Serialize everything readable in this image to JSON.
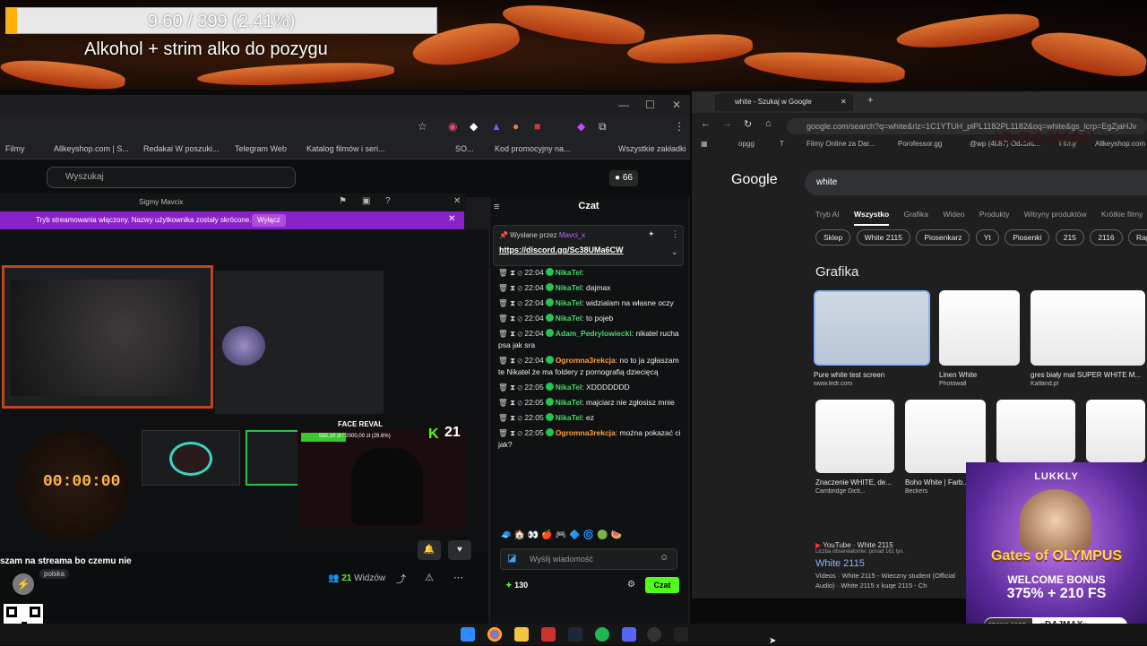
{
  "overlay": {
    "progress_text": "9.60 / 399 (2.41%)",
    "progress_fraction": 0.0241,
    "stream_title": "Alkohol + strim alko do pozygu"
  },
  "left_browser": {
    "bookmarks": [
      "Filmy",
      "Allkeyshop.com | S...",
      "Redakai W poszuki...",
      "Telegram Web",
      "Katalog filmów i seri...",
      "SO...",
      "Kod promocyjny na...",
      "Wszystkie zakładki"
    ],
    "search_placeholder": "Wyszukaj",
    "viewer_badge": "66"
  },
  "popout": {
    "window_title": "Sigmy Mavcix",
    "notice": "Tryb streamowania włączony. Nazwy użytkownika zostały skrócone.",
    "notice_button": "Wyłącz",
    "timer": "00:00:00",
    "face_reveal": "FACE REVAL",
    "goal_text": "592,10 zł / 2000,00 zł (29.6%)",
    "kick_count": "21"
  },
  "stream_info": {
    "description": "szam na streama bo czemu nie",
    "tag": "polska",
    "viewers_count": "21",
    "viewers_label": "Widzów"
  },
  "chat": {
    "title": "Czat",
    "pinned_by": "Wysłane przez",
    "pinned_user": "Mavci_x",
    "pinned_link": "https://discord.gg/Sc38UMa6CW",
    "messages": [
      {
        "time": "22:04",
        "user": "NikaTel",
        "text": ":",
        "color": "green"
      },
      {
        "time": "22:04",
        "user": "NikaTel",
        "text": ": dajmax",
        "color": "green"
      },
      {
        "time": "22:04",
        "user": "NikaTel",
        "text": ": widzialam na własne oczy",
        "color": "green"
      },
      {
        "time": "22:04",
        "user": "NikaTel",
        "text": ": to pojeb",
        "color": "green"
      },
      {
        "time": "22:04",
        "user": "Adam_Pedrylowiecki",
        "text": ": nikatel rucha psa jak sra",
        "color": "green"
      },
      {
        "time": "22:04",
        "user": "Ogromna3rekcja",
        "text": ": no to ja zgłaszam te Nikatel że ma foldery z pornografią dziecięcą",
        "color": "orange"
      },
      {
        "time": "22:05",
        "user": "NikaTel",
        "text": ": XDDDDDDD",
        "color": "green"
      },
      {
        "time": "22:05",
        "user": "NikaTel",
        "text": ": majciarz nie zgłosisz mnie",
        "color": "green"
      },
      {
        "time": "22:05",
        "user": "NikaTel",
        "text": ": ez",
        "color": "green"
      },
      {
        "time": "22:05",
        "user": "Ogromna3rekcja",
        "text": ": można pokazać ci jak?",
        "color": "orange"
      }
    ],
    "input_placeholder": "Wyślij wiadomość",
    "points": "130",
    "send_label": "Czat"
  },
  "right_browser": {
    "tab_title": "white - Szukaj w Google",
    "url": "google.com/search?q=white&rlz=1C1YTUH_plPL1182PL1182&oq=white&gs_lcrp=EgZjaHJv",
    "bookmarks": [
      "opgg",
      "T",
      "Filmy Online za Dar...",
      "Porofessor.gg",
      "@wp (4887) Odebra...",
      "Filmy",
      "Allkeyshop.com"
    ],
    "google_logo": "Google",
    "query": "white",
    "tabs": [
      "Tryb AI",
      "Wszystko",
      "Grafika",
      "Wideo",
      "Produkty",
      "Witryny produktów",
      "Krótkie filmy"
    ],
    "chips": [
      "Sklep",
      "White 2115",
      "Piosenkarz",
      "Yt",
      "Piosenki",
      "215",
      "2116",
      "Rapper"
    ],
    "section_title": "Grafika",
    "images_row1": [
      {
        "caption": "Pure white test screen",
        "source": "www.ledr.com"
      },
      {
        "caption": "Linen White",
        "source": "Photowall"
      },
      {
        "caption": "gres biały mat SUPER WHITE M...",
        "source": "Kafland.pl"
      }
    ],
    "images_row2": [
      {
        "caption": "Znaczenie WHITE, de...",
        "source": "Cambridge Dicti..."
      },
      {
        "caption": "Boho White | Farb...",
        "source": "Beckers"
      }
    ],
    "result": {
      "source": "YouTube · White 2115",
      "sub": "Liczba obserwatorów: ponad 161 tys.",
      "title": "White 2115",
      "desc": "Videos · White 2115 - Wieczny student (Official Audio) · White 2115 x kuqe 2115 - Ch"
    }
  },
  "ad": {
    "brand": "LUKKLY",
    "game": "Gates of OLYMPUS",
    "welcome": "WELCOME BONUS",
    "bonus": "375% + 210 FS",
    "promo_label": "PROMO CODE:",
    "promo_code": "«DAJMAX»"
  },
  "watermark": "IG DAJMAX"
}
